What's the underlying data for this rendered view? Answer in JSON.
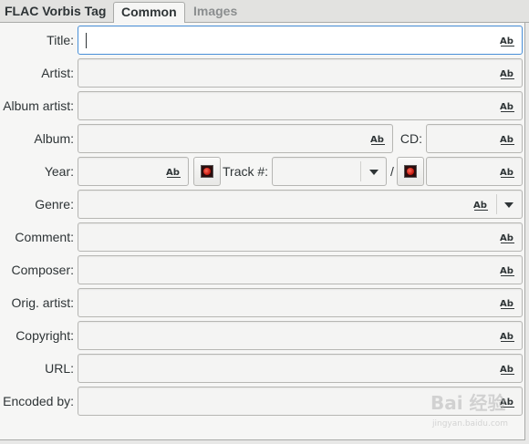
{
  "tab_bar": {
    "group_title": "FLAC Vorbis Tag",
    "tabs": [
      {
        "label": "Common",
        "active": true
      },
      {
        "label": "Images",
        "active": false
      }
    ]
  },
  "form": {
    "title_label": "Title:",
    "artist_label": "Artist:",
    "album_artist_label": "Album artist:",
    "album_label": "Album:",
    "cd_label": "CD:",
    "year_label": "Year:",
    "track_label": "Track #:",
    "track_separator": "/",
    "genre_label": "Genre:",
    "comment_label": "Comment:",
    "composer_label": "Composer:",
    "orig_artist_label": "Orig. artist:",
    "copyright_label": "Copyright:",
    "url_label": "URL:",
    "encoded_by_label": "Encoded by:"
  },
  "values": {
    "title": "",
    "artist": "",
    "album_artist": "",
    "album": "",
    "cd": "",
    "year": "",
    "track": "",
    "track_total": "",
    "genre": "",
    "comment": "",
    "composer": "",
    "orig_artist": "",
    "copyright": "",
    "url": "",
    "encoded_by": ""
  },
  "icons": {
    "field_case_icon": "Ab-text-case-icon",
    "image_button_icon": "image-icon",
    "dropdown_icon": "chevron-down-icon"
  },
  "watermark": {
    "line1": "Bai 经验",
    "line2": "jingyan.baidu.com"
  },
  "colors": {
    "focus_border": "#4a90d9",
    "text": "#2e3436",
    "inactive_tab": "#8b8e8f"
  }
}
